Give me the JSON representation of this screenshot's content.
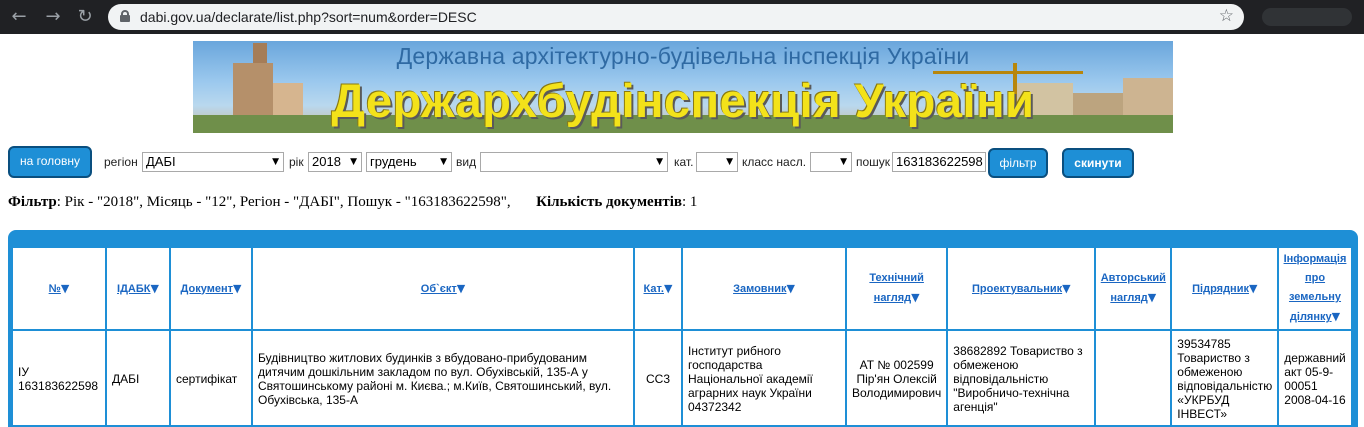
{
  "browser": {
    "url": "dabi.gov.ua/declarate/list.php?sort=num&order=DESC",
    "back_icon": "←",
    "forward_icon": "→",
    "reload_icon": "↻",
    "star_icon": "☆"
  },
  "banner": {
    "top_text": "Державна архітектурно-будівельна інспекція України",
    "main_text": "Держархбудінспекція України"
  },
  "filters": {
    "home_button": "на головну",
    "region_label": "регіон",
    "region_value": "ДАБІ",
    "year_label": "рік",
    "year_value": "2018",
    "month_value": "грудень",
    "type_label": "вид",
    "type_value": "",
    "cat_label": "кат.",
    "cat_value": "",
    "class_label": "класс насл.",
    "class_value": "",
    "search_label": "пошук",
    "search_value": "163183622598",
    "filter_button": "фільтр",
    "reset_button": "скинути"
  },
  "summary": {
    "filter_label": "Фільтр",
    "filter_text": ": Рік - \"2018\", Місяць - \"12\", Регіон - \"ДАБІ\", Пошук - \"163183622598\",",
    "count_label": "Кількість документів",
    "count_value": ": 1"
  },
  "table": {
    "headers": [
      {
        "label": "№"
      },
      {
        "label": "ІДАБК"
      },
      {
        "label": "Документ"
      },
      {
        "label": "Об`єкт"
      },
      {
        "label": "Кат."
      },
      {
        "label": "Замовник"
      },
      {
        "label": "Технічний нагляд"
      },
      {
        "label": "Проектувальник"
      },
      {
        "label": "Авторський нагляд"
      },
      {
        "label": "Підрядник"
      },
      {
        "label": "Інформація про земельну ділянку"
      }
    ],
    "sort_icon": "▼",
    "row": {
      "num": "ІУ 163183622598",
      "idabk": "ДАБІ",
      "document": "сертифікат",
      "object": "Будівництво житлових будинків з вбудовано-прибудованим дитячим дошкільним закладом по вул. Обухівській, 135-А у Святошинському районі м. Києва.; м.Київ, Святошинський, вул. Обухівська, 135-А",
      "category": "СС3",
      "customer": "Інститут рибного господарства Національної академії аграрних наук України 04372342",
      "tech_supervision": "АТ № 002599 Пір'ян Олексій Володимирович",
      "designer": "38682892 Товариство з обмеженою відповідальністю \"Виробничо-технічна агенція\"",
      "author_supervision": "",
      "contractor": "39534785 Товариство з обмеженою відповідальністю «УКРБУД ІНВЕСТ»",
      "land_info": "державний акт 05-9-00051 2008-04-16"
    }
  }
}
